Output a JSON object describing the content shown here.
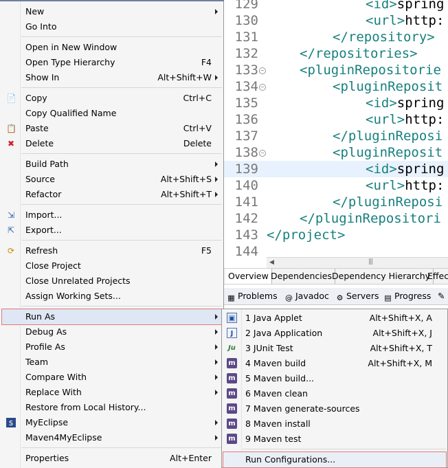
{
  "editor": {
    "lines": [
      {
        "num": "129",
        "fold": false,
        "hl": false,
        "indent": 3,
        "parts": [
          {
            "t": "<id>",
            "c": "tag"
          },
          {
            "t": "spring",
            "c": "txt"
          }
        ]
      },
      {
        "num": "130",
        "fold": false,
        "hl": false,
        "indent": 3,
        "parts": [
          {
            "t": "<url>",
            "c": "tag"
          },
          {
            "t": "http:",
            "c": "txt"
          }
        ]
      },
      {
        "num": "131",
        "fold": false,
        "hl": false,
        "indent": 2,
        "parts": [
          {
            "t": "</repository>",
            "c": "tag"
          }
        ]
      },
      {
        "num": "132",
        "fold": false,
        "hl": false,
        "indent": 1,
        "parts": [
          {
            "t": "</repositories>",
            "c": "tag"
          }
        ]
      },
      {
        "num": "133",
        "fold": true,
        "hl": false,
        "indent": 1,
        "parts": [
          {
            "t": "<pluginRepositorie",
            "c": "tag"
          }
        ]
      },
      {
        "num": "134",
        "fold": true,
        "hl": false,
        "indent": 2,
        "parts": [
          {
            "t": "<pluginReposit",
            "c": "tag"
          }
        ]
      },
      {
        "num": "135",
        "fold": false,
        "hl": false,
        "indent": 3,
        "parts": [
          {
            "t": "<id>",
            "c": "tag"
          },
          {
            "t": "spring",
            "c": "txt"
          }
        ]
      },
      {
        "num": "136",
        "fold": false,
        "hl": false,
        "indent": 3,
        "parts": [
          {
            "t": "<url>",
            "c": "tag"
          },
          {
            "t": "http:",
            "c": "txt"
          }
        ]
      },
      {
        "num": "137",
        "fold": false,
        "hl": false,
        "indent": 2,
        "parts": [
          {
            "t": "</pluginReposi",
            "c": "tag"
          }
        ]
      },
      {
        "num": "138",
        "fold": true,
        "hl": false,
        "indent": 2,
        "parts": [
          {
            "t": "<pluginReposit",
            "c": "tag"
          }
        ]
      },
      {
        "num": "139",
        "fold": false,
        "hl": true,
        "indent": 3,
        "parts": [
          {
            "t": "<id>",
            "c": "tag"
          },
          {
            "t": "spring",
            "c": "txt"
          }
        ]
      },
      {
        "num": "140",
        "fold": false,
        "hl": false,
        "indent": 3,
        "parts": [
          {
            "t": "<url>",
            "c": "tag"
          },
          {
            "t": "http:",
            "c": "txt"
          }
        ]
      },
      {
        "num": "141",
        "fold": false,
        "hl": false,
        "indent": 2,
        "parts": [
          {
            "t": "</pluginReposi",
            "c": "tag"
          }
        ]
      },
      {
        "num": "142",
        "fold": false,
        "hl": false,
        "indent": 1,
        "parts": [
          {
            "t": "</pluginRepositori",
            "c": "tag"
          }
        ]
      },
      {
        "num": "143",
        "fold": false,
        "hl": false,
        "indent": 0,
        "parts": [
          {
            "t": "</project>",
            "c": "tag"
          }
        ]
      },
      {
        "num": "144",
        "fold": false,
        "hl": false,
        "indent": 0,
        "parts": []
      }
    ]
  },
  "pom_tabs": [
    "Overview",
    "Dependencies",
    "Dependency Hierarchy",
    "Effect"
  ],
  "view_tabs": [
    {
      "label": "Problems",
      "icon": "problems-icon",
      "glyph": "▦"
    },
    {
      "label": "Javadoc",
      "icon": "javadoc-icon",
      "glyph": "@"
    },
    {
      "label": "Servers",
      "icon": "servers-icon",
      "glyph": "⚙"
    },
    {
      "label": "Progress",
      "icon": "progress-icon",
      "glyph": "▤"
    }
  ],
  "context_menu": {
    "items": [
      {
        "label": "New",
        "shortcut": "",
        "submenu": true,
        "icon": "",
        "glyph": ""
      },
      {
        "label": "Go Into",
        "shortcut": "",
        "submenu": false,
        "icon": "",
        "glyph": ""
      },
      {
        "sep": true
      },
      {
        "label": "Open in New Window",
        "shortcut": "",
        "submenu": false,
        "icon": "",
        "glyph": ""
      },
      {
        "label": "Open Type Hierarchy",
        "shortcut": "F4",
        "submenu": false,
        "icon": "",
        "glyph": ""
      },
      {
        "label": "Show In",
        "shortcut": "Alt+Shift+W",
        "submenu": true,
        "icon": "",
        "glyph": ""
      },
      {
        "sep": true
      },
      {
        "label": "Copy",
        "shortcut": "Ctrl+C",
        "submenu": false,
        "icon": "copy-icon",
        "glyph": "📄"
      },
      {
        "label": "Copy Qualified Name",
        "shortcut": "",
        "submenu": false,
        "icon": "",
        "glyph": ""
      },
      {
        "label": "Paste",
        "shortcut": "Ctrl+V",
        "submenu": false,
        "icon": "paste-icon",
        "glyph": "📋"
      },
      {
        "label": "Delete",
        "shortcut": "Delete",
        "submenu": false,
        "icon": "delete-icon",
        "glyph": "✖"
      },
      {
        "sep": true
      },
      {
        "label": "Build Path",
        "shortcut": "",
        "submenu": true,
        "icon": "",
        "glyph": ""
      },
      {
        "label": "Source",
        "shortcut": "Alt+Shift+S",
        "submenu": true,
        "icon": "",
        "glyph": ""
      },
      {
        "label": "Refactor",
        "shortcut": "Alt+Shift+T",
        "submenu": true,
        "icon": "",
        "glyph": ""
      },
      {
        "sep": true
      },
      {
        "label": "Import...",
        "shortcut": "",
        "submenu": false,
        "icon": "import-icon",
        "glyph": "⇲"
      },
      {
        "label": "Export...",
        "shortcut": "",
        "submenu": false,
        "icon": "export-icon",
        "glyph": "⇱"
      },
      {
        "sep": true
      },
      {
        "label": "Refresh",
        "shortcut": "F5",
        "submenu": false,
        "icon": "refresh-icon",
        "glyph": "⟳"
      },
      {
        "label": "Close Project",
        "shortcut": "",
        "submenu": false,
        "icon": "",
        "glyph": ""
      },
      {
        "label": "Close Unrelated Projects",
        "shortcut": "",
        "submenu": false,
        "icon": "",
        "glyph": ""
      },
      {
        "label": "Assign Working Sets...",
        "shortcut": "",
        "submenu": false,
        "icon": "",
        "glyph": ""
      },
      {
        "sep": true
      },
      {
        "label": "Run As",
        "shortcut": "",
        "submenu": true,
        "icon": "",
        "glyph": "",
        "active": true
      },
      {
        "label": "Debug As",
        "shortcut": "",
        "submenu": true,
        "icon": "",
        "glyph": ""
      },
      {
        "label": "Profile As",
        "shortcut": "",
        "submenu": true,
        "icon": "",
        "glyph": ""
      },
      {
        "label": "Team",
        "shortcut": "",
        "submenu": true,
        "icon": "",
        "glyph": ""
      },
      {
        "label": "Compare With",
        "shortcut": "",
        "submenu": true,
        "icon": "",
        "glyph": ""
      },
      {
        "label": "Replace With",
        "shortcut": "",
        "submenu": true,
        "icon": "",
        "glyph": ""
      },
      {
        "label": "Restore from Local History...",
        "shortcut": "",
        "submenu": false,
        "icon": "",
        "glyph": ""
      },
      {
        "label": "MyEclipse",
        "shortcut": "",
        "submenu": true,
        "icon": "myeclipse-icon",
        "glyph": "ꜱ"
      },
      {
        "label": "Maven4MyEclipse",
        "shortcut": "",
        "submenu": true,
        "icon": "",
        "glyph": ""
      },
      {
        "sep": true
      },
      {
        "label": "Properties",
        "shortcut": "Alt+Enter",
        "submenu": false,
        "icon": "",
        "glyph": ""
      }
    ]
  },
  "run_as_submenu": {
    "items": [
      {
        "label": "1 Java Applet",
        "shortcut": "Alt+Shift+X, A",
        "icon": "java-applet-icon",
        "kind": "app",
        "glyph": "▣"
      },
      {
        "label": "2 Java Application",
        "shortcut": "Alt+Shift+X, J",
        "icon": "java-application-icon",
        "kind": "j",
        "glyph": "J"
      },
      {
        "label": "3 JUnit Test",
        "shortcut": "Alt+Shift+X, T",
        "icon": "junit-icon",
        "kind": "ju",
        "glyph": "Ju"
      },
      {
        "label": "4 Maven build",
        "shortcut": "Alt+Shift+X, M",
        "icon": "maven-icon",
        "kind": "m",
        "glyph": "m"
      },
      {
        "label": "5 Maven build...",
        "shortcut": "",
        "icon": "maven-icon",
        "kind": "m",
        "glyph": "m"
      },
      {
        "label": "6 Maven clean",
        "shortcut": "",
        "icon": "maven-icon",
        "kind": "m",
        "glyph": "m"
      },
      {
        "label": "7 Maven generate-sources",
        "shortcut": "",
        "icon": "maven-icon",
        "kind": "m",
        "glyph": "m"
      },
      {
        "label": "8 Maven install",
        "shortcut": "",
        "icon": "maven-icon",
        "kind": "m",
        "glyph": "m"
      },
      {
        "label": "9 Maven test",
        "shortcut": "",
        "icon": "maven-icon",
        "kind": "m",
        "glyph": "m"
      },
      {
        "sep": true
      },
      {
        "label": "Run Configurations...",
        "shortcut": "",
        "icon": "",
        "kind": "",
        "glyph": "",
        "active": true
      }
    ]
  },
  "colors": {
    "tag": "#17807e",
    "highlight_border": "#e27878",
    "current_line": "#e8f2fe"
  }
}
